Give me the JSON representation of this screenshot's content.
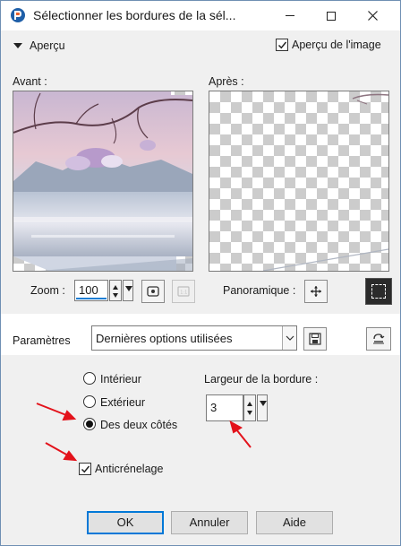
{
  "window": {
    "title": "Sélectionner les bordures de la sél...",
    "app_icon": "paintshop-pro-icon",
    "controls": [
      "minimize-icon",
      "maximize-icon",
      "close-icon"
    ]
  },
  "preview": {
    "toggle_label": "Aperçu",
    "image_preview_label": "Aperçu de l'image",
    "image_preview_checked": true,
    "before_label": "Avant :",
    "after_label": "Après :"
  },
  "zoom": {
    "label": "Zoom :",
    "value": "100",
    "pan_label": "Panoramique :"
  },
  "params": {
    "label": "Paramètres",
    "preset_value": "Dernières options utilisées"
  },
  "options": {
    "interior_label": "Intérieur",
    "exterior_label": "Extérieur",
    "both_label": "Des deux côtés",
    "selected": "both",
    "antialias_label": "Anticrénelage",
    "antialias_checked": true,
    "border_width_label": "Largeur de la bordure :",
    "border_width_value": "3"
  },
  "buttons": {
    "ok": "OK",
    "cancel": "Annuler",
    "help": "Aide"
  },
  "annotation_color": "#e3121b"
}
